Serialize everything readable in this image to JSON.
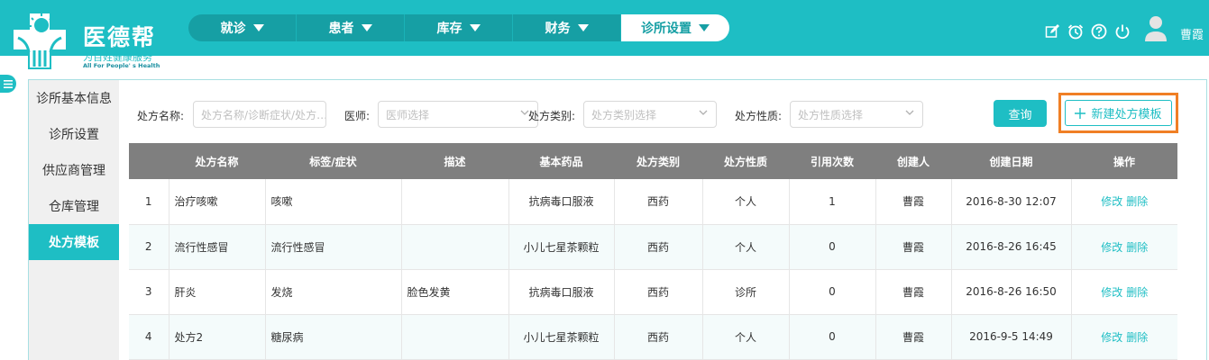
{
  "header": {
    "logo_title": "医德帮",
    "logo_subtitle": "为百姓健康服务",
    "logo_tagline": "All For People' s Health",
    "nav": [
      {
        "label": "就诊",
        "active": false
      },
      {
        "label": "患者",
        "active": false
      },
      {
        "label": "库存",
        "active": false
      },
      {
        "label": "财务",
        "active": false
      },
      {
        "label": "诊所设置",
        "active": true
      }
    ],
    "icons": [
      "edit-icon",
      "alarm-clock-icon",
      "help-icon",
      "power-icon"
    ],
    "username": "曹霞"
  },
  "sidebar": {
    "items": [
      {
        "label": "诊所基本信息",
        "active": false
      },
      {
        "label": "诊所设置",
        "active": false
      },
      {
        "label": "供应商管理",
        "active": false
      },
      {
        "label": "仓库管理",
        "active": false
      },
      {
        "label": "处方模板",
        "active": true
      }
    ]
  },
  "search": {
    "name_label": "处方名称:",
    "name_placeholder": "处方名称/诊断症状/处方…",
    "doctor_label": "医师:",
    "doctor_placeholder": "医师选择",
    "type_label": "处方类别:",
    "type_placeholder": "处方类别选择",
    "nature_label": "处方性质:",
    "nature_placeholder": "处方性质选择",
    "query_button": "查询",
    "new_button": "新建处方模板"
  },
  "table": {
    "columns": [
      "",
      "处方名称",
      "标签/症状",
      "描述",
      "基本药品",
      "处方类别",
      "处方性质",
      "引用次数",
      "创建人",
      "创建日期",
      "操作"
    ],
    "rows": [
      [
        "1",
        "治疗咳嗽",
        "咳嗽",
        "",
        "抗病毒口服液",
        "西药",
        "个人",
        "1",
        "曹霞",
        "2016-8-30 12:07"
      ],
      [
        "2",
        "流行性感冒",
        "流行性感冒",
        "",
        "小儿七星茶颗粒",
        "西药",
        "个人",
        "0",
        "曹霞",
        "2016-8-26 16:45"
      ],
      [
        "3",
        "肝炎",
        "发烧",
        "脸色发黄",
        "抗病毒口服液",
        "西药",
        "诊所",
        "0",
        "曹霞",
        "2016-8-26 16:50"
      ],
      [
        "4",
        "处方2",
        "糖尿病",
        "",
        "小儿七星茶颗粒",
        "西药",
        "个人",
        "0",
        "曹霞",
        "2016-9-5 14:49"
      ]
    ],
    "edit_label": "修改",
    "delete_label": "删除"
  },
  "colors": {
    "primary": "#1ebec4",
    "nav_dark": "#169fa4",
    "highlight": "#f07f25",
    "table_header": "#7f7f7f"
  }
}
